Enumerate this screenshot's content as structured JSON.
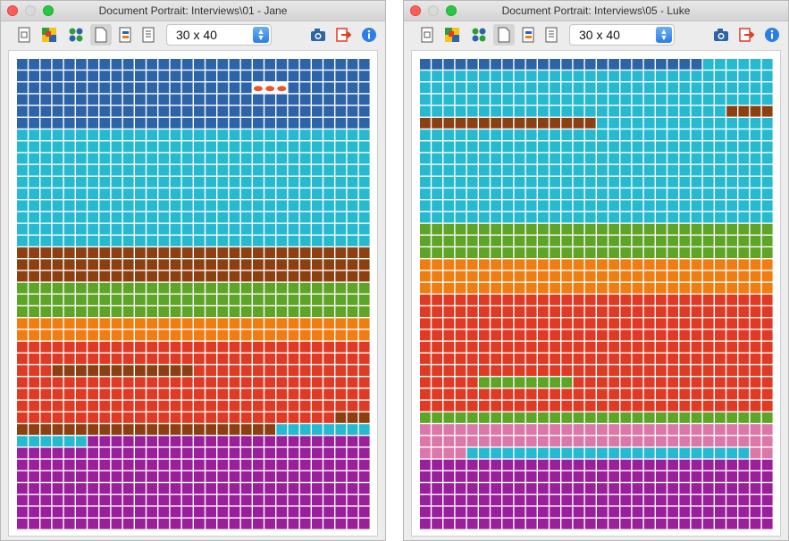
{
  "windows": [
    {
      "title": "Document Portrait: Interviews\\01 - Jane",
      "grid_select": "30 x 40",
      "portrait_rows": [
        "000000000000000000000000000000",
        "000000000000000000000000000000",
        "00000000000000000000SSS0000000",
        "000000000000000000000000000000",
        "000000000000000000000000000000",
        "000000000000000000000000000000",
        "111111111111111111111111111111",
        "111111111111111111111111111111",
        "111111111111111111111111111111",
        "111111111111111111111111111111",
        "111111111111111111111111111111",
        "111111111111111111111111111111",
        "111111111111111111111111111111",
        "111111111111111111111111111111",
        "111111111111111111111111111111",
        "111111111111111111111111111111",
        "222222222222222222222222222222",
        "222222222222222222222222222222",
        "222222222222222222222222222222",
        "333333333333333333333333333333",
        "333333333333333333333333333333",
        "333333333333333333333333333333",
        "444444444444444444444444444444",
        "444444444444444444444444444444",
        "555555555555555555555555555555",
        "555555555555555555555555555555",
        "555222222222222555555555555555",
        "555555555555555555555555555555",
        "555555555555555555555555555555",
        "555555555555555555555555555555",
        "555555555555555555555555555222",
        "222222222222222222222211111111",
        "111111666666666666666666666666",
        "666666666666666666666666666666",
        "666666666666666666666666666666",
        "666666666666666666666666666666",
        "666666666666666666666666666666",
        "666666666666666666666666666666",
        "666666666666666666666666666666",
        "666666666666666666666666666666"
      ]
    },
    {
      "title": "Document Portrait: Interviews\\05 - Luke",
      "grid_select": "30 x 40",
      "portrait_rows": [
        "000000000000000000000000111111",
        "111111111111111111111111111111",
        "111111111111111111111111111111",
        "111111111111111111111111111111",
        "111111111111111111111111112222",
        "222222222222222111111111111111",
        "111111111111111111111111111111",
        "111111111111111111111111111111",
        "111111111111111111111111111111",
        "111111111111111111111111111111",
        "111111111111111111111111111111",
        "111111111111111111111111111111",
        "111111111111111111111111111111",
        "111111111111111111111111111111",
        "333333333333333333333333333333",
        "333333333333333333333333333333",
        "333333333333333333333333333333",
        "444444444444444444444444444444",
        "444444444444444444444444444444",
        "444444444444444444444444444444",
        "555555555555555555555555555555",
        "555555555555555555555555555555",
        "555555555555555555555555555555",
        "555555555555555555555555555555",
        "555555555555555555555555555555",
        "555555555555555555555555555555",
        "555555555555555555555555555555",
        "555553333333355555555555555555",
        "555555555555555555555555555555",
        "555555555555555555555555555555",
        "333333333333333333333333333333",
        "777777777777777777777777777777",
        "777777777777777777777777777777",
        "777711111111111111111111111177",
        "666666666666666666666666666666",
        "666666666666666666666666666666",
        "666666666666666666666666666666",
        "666666666666666666666666666666",
        "666666666666666666666666666666",
        "666666666666666666666666666666"
      ]
    }
  ],
  "palette": {
    "0": "#2d64a8",
    "1": "#27b9cf",
    "2": "#8c4012",
    "3": "#5ea427",
    "4": "#ef7d12",
    "5": "#e13a24",
    "6": "#9a1f9a",
    "7": "#db77a9",
    "S": "#e9552a"
  },
  "toolbar_icons": [
    "document-icon",
    "color-image-icon",
    "four-dots-icon",
    "portrait-page-icon",
    "export-page-icon",
    "layout-icon",
    "camera-icon",
    "exit-icon",
    "info-icon"
  ],
  "window_controls": {
    "close": "#ff5f57",
    "minimize": "#dadada",
    "zoom": "#28c840"
  }
}
